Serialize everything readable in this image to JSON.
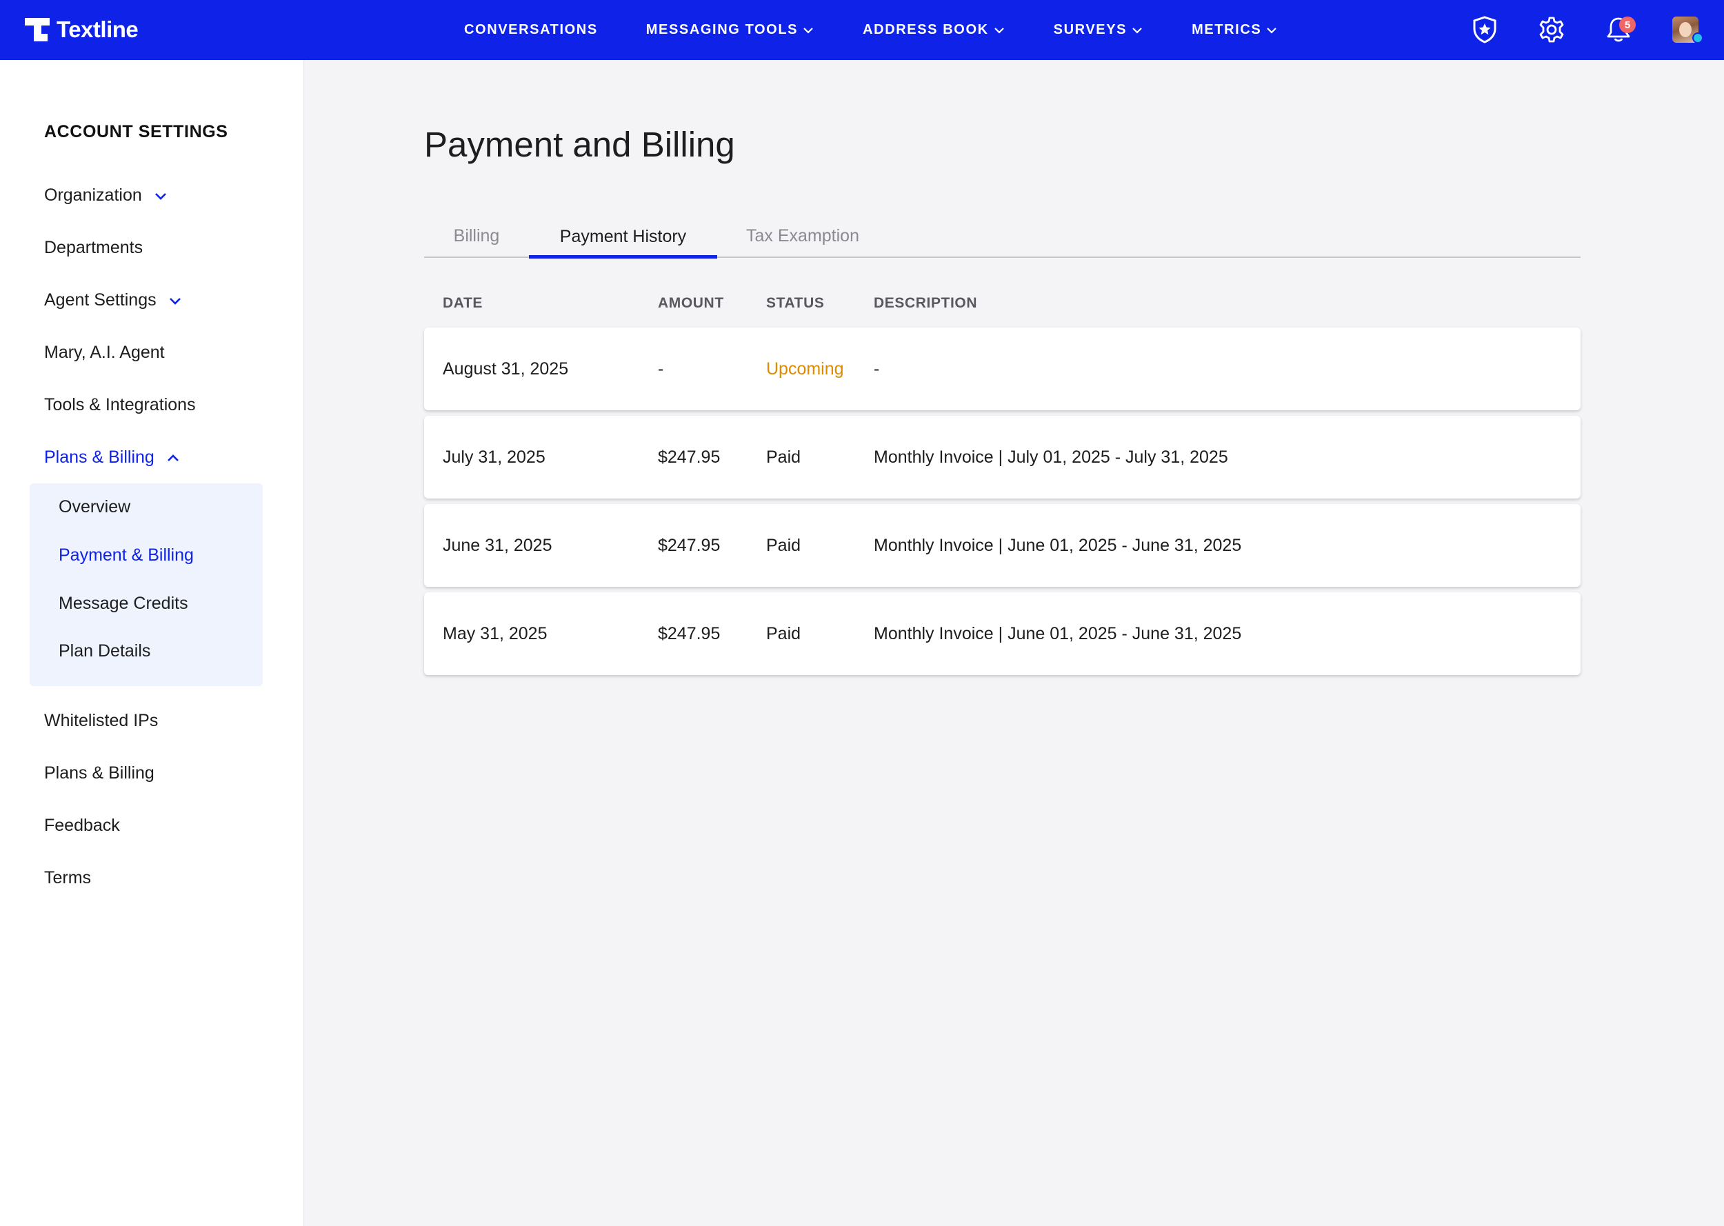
{
  "brand": {
    "name": "Textline",
    "accent": "#0f23e8"
  },
  "nav": {
    "items": [
      {
        "label": "CONVERSATIONS",
        "dropdown": false
      },
      {
        "label": "MESSAGING TOOLS",
        "dropdown": true
      },
      {
        "label": "ADDRESS BOOK",
        "dropdown": true
      },
      {
        "label": "SURVEYS",
        "dropdown": true
      },
      {
        "label": "METRICS",
        "dropdown": true
      }
    ],
    "icons": [
      "shield-star-icon",
      "gear-icon",
      "bell-icon",
      "avatar"
    ],
    "notification_count": "5"
  },
  "sidebar": {
    "title": "ACCOUNT SETTINGS",
    "items": [
      {
        "label": "Organization",
        "chevron": "down"
      },
      {
        "label": "Departments"
      },
      {
        "label": "Agent Settings",
        "chevron": "down"
      },
      {
        "label": "Mary, A.I. Agent"
      },
      {
        "label": "Tools & Integrations"
      },
      {
        "label": "Plans & Billing",
        "chevron": "up",
        "active": true
      },
      {
        "label": "Whitelisted IPs"
      },
      {
        "label": "Plans & Billing"
      },
      {
        "label": "Feedback"
      },
      {
        "label": "Terms"
      }
    ],
    "submenu": [
      {
        "label": "Overview"
      },
      {
        "label": "Payment & Billing",
        "active": true
      },
      {
        "label": "Message Credits"
      },
      {
        "label": "Plan Details"
      }
    ]
  },
  "main": {
    "title": "Payment and Billing",
    "tabs": [
      {
        "label": "Billing"
      },
      {
        "label": "Payment History",
        "active": true
      },
      {
        "label": "Tax Examption"
      }
    ],
    "table": {
      "headers": {
        "date": "DATE",
        "amount": "AMOUNT",
        "status": "STATUS",
        "description": "DESCRIPTION"
      },
      "rows": [
        {
          "date": "August 31, 2025",
          "amount": "-",
          "status": "Upcoming",
          "description": "-"
        },
        {
          "date": "July 31, 2025",
          "amount": "$247.95",
          "status": "Paid",
          "description": "Monthly Invoice | July 01, 2025 - July 31, 2025"
        },
        {
          "date": "June 31, 2025",
          "amount": "$247.95",
          "status": "Paid",
          "description": "Monthly Invoice | June 01, 2025 - June 31, 2025"
        },
        {
          "date": "May 31, 2025",
          "amount": "$247.95",
          "status": "Paid",
          "description": "Monthly Invoice | June 01, 2025 - June 31, 2025"
        }
      ],
      "status_colors": {
        "Upcoming": "#e08a00",
        "Paid": "#1d1d1f"
      }
    }
  }
}
